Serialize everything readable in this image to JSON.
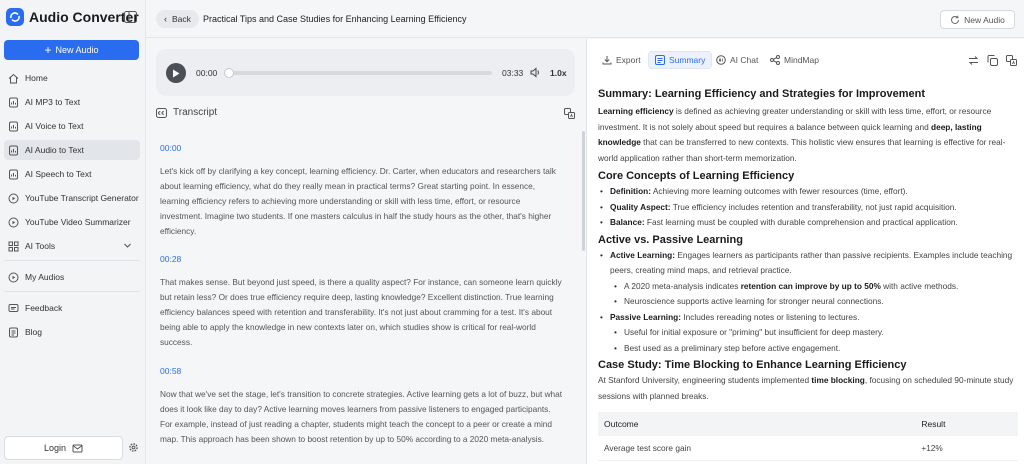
{
  "app": {
    "title": "Audio Converter",
    "accent": "#2a6cf0"
  },
  "sidebar": {
    "new_audio": "New Audio",
    "items": [
      {
        "label": "Home",
        "icon": "home-icon"
      },
      {
        "label": "AI MP3 to Text",
        "icon": "file-icon"
      },
      {
        "label": "AI Voice to Text",
        "icon": "file-icon"
      },
      {
        "label": "AI Audio to Text",
        "icon": "file-icon",
        "active": true
      },
      {
        "label": "AI Speech to Text",
        "icon": "file-icon"
      },
      {
        "label": "YouTube Transcript Generator",
        "icon": "play-circle-icon"
      },
      {
        "label": "YouTube Video Summarizer",
        "icon": "play-circle-icon"
      },
      {
        "label": "AI Tools",
        "icon": "grid-icon"
      },
      {
        "label": "My Audios",
        "icon": "play-circle-icon"
      },
      {
        "label": "Feedback",
        "icon": "message-icon"
      },
      {
        "label": "Blog",
        "icon": "document-icon"
      }
    ],
    "login": "Login"
  },
  "topbar": {
    "back": "Back",
    "title": "Practical Tips and Case Studies for Enhancing Learning Efficiency",
    "new_audio": "New Audio"
  },
  "player": {
    "current": "00:00",
    "duration": "03:33",
    "speed": "1.0x",
    "progress": 0
  },
  "transcript": {
    "heading": "Transcript",
    "segments": [
      {
        "time": "00:00",
        "text": "Let's kick off by clarifying a key concept, learning efficiency. Dr. Carter, when educators and researchers talk about learning efficiency, what do they really mean in practical terms? Great starting point. In essence, learning efficiency refers to achieving more understanding or skill with less time, effort, or resource investment. Imagine two students. If one masters calculus in half the study hours as the other, that's higher efficiency."
      },
      {
        "time": "00:28",
        "text": "That makes sense. But beyond just speed, is there a quality aspect? For instance, can someone learn quickly but retain less? Or does true efficiency require deep, lasting knowledge? Excellent distinction. True learning efficiency balances speed with retention and transferability. It's not just about cramming for a test. It's about being able to apply the knowledge in new contexts later on, which studies show is critical for real-world success."
      },
      {
        "time": "00:58",
        "text": "Now that we've set the stage, let's transition to concrete strategies. Active learning gets a lot of buzz, but what does it look like day to day? Active learning moves learners from passive listeners to engaged participants. For example, instead of just reading a chapter, students might teach the concept to a peer or create a mind map. This approach has been shown to boost retention by up to 50% according to a 2020 meta-analysis."
      }
    ]
  },
  "right_tabs": {
    "export": "Export",
    "summary": "Summary",
    "ai_chat": "AI Chat",
    "mindmap": "MindMap"
  },
  "summary": {
    "title": "Summary: Learning Efficiency and Strategies for Improvement",
    "intro": {
      "b1": "Learning efficiency",
      "t1": " is defined as achieving greater understanding or skill with less time, effort, or resource investment. It is not solely about speed but requires a balance between quick learning and ",
      "b2": "deep, lasting knowledge",
      "t2": " that can be transferred to new contexts. This holistic view ensures that learning is effective for real-world application rather than short-term memorization."
    },
    "core": {
      "heading": "Core Concepts of Learning Efficiency",
      "items": [
        {
          "label": "Definition:",
          "text": " Achieving more learning outcomes with fewer resources (time, effort)."
        },
        {
          "label": "Quality Aspect:",
          "text": " True efficiency includes retention and transferability, not just rapid acquisition."
        },
        {
          "label": "Balance:",
          "text": " Fast learning must be coupled with durable comprehension and practical application."
        }
      ]
    },
    "active": {
      "heading": "Active vs. Passive Learning",
      "active_label": "Active Learning:",
      "active_text": " Engages learners as participants rather than passive recipients. Examples include teaching peers, creating mind maps, and retrieval practice.",
      "sub1_pre": "A 2020 meta-analysis indicates ",
      "sub1_bold": "retention can improve by up to 50%",
      "sub1_post": " with active methods.",
      "sub2": "Neuroscience supports active learning for stronger neural connections.",
      "passive_label": "Passive Learning:",
      "passive_text": " Includes rereading notes or listening to lectures.",
      "sub3": "Useful for initial exposure or \"priming\" but insufficient for deep mastery.",
      "sub4": "Best used as a preliminary step before active engagement."
    },
    "case": {
      "heading": "Case Study: Time Blocking to Enhance Learning Efficiency",
      "pre": "At Stanford University, engineering students implemented ",
      "bold": "time blocking",
      "post": ", focusing on scheduled 90-minute study sessions with planned breaks."
    },
    "table": {
      "headers": [
        "Outcome",
        "Result"
      ],
      "rows": [
        [
          "Average test score gain",
          "+12%"
        ]
      ]
    }
  }
}
